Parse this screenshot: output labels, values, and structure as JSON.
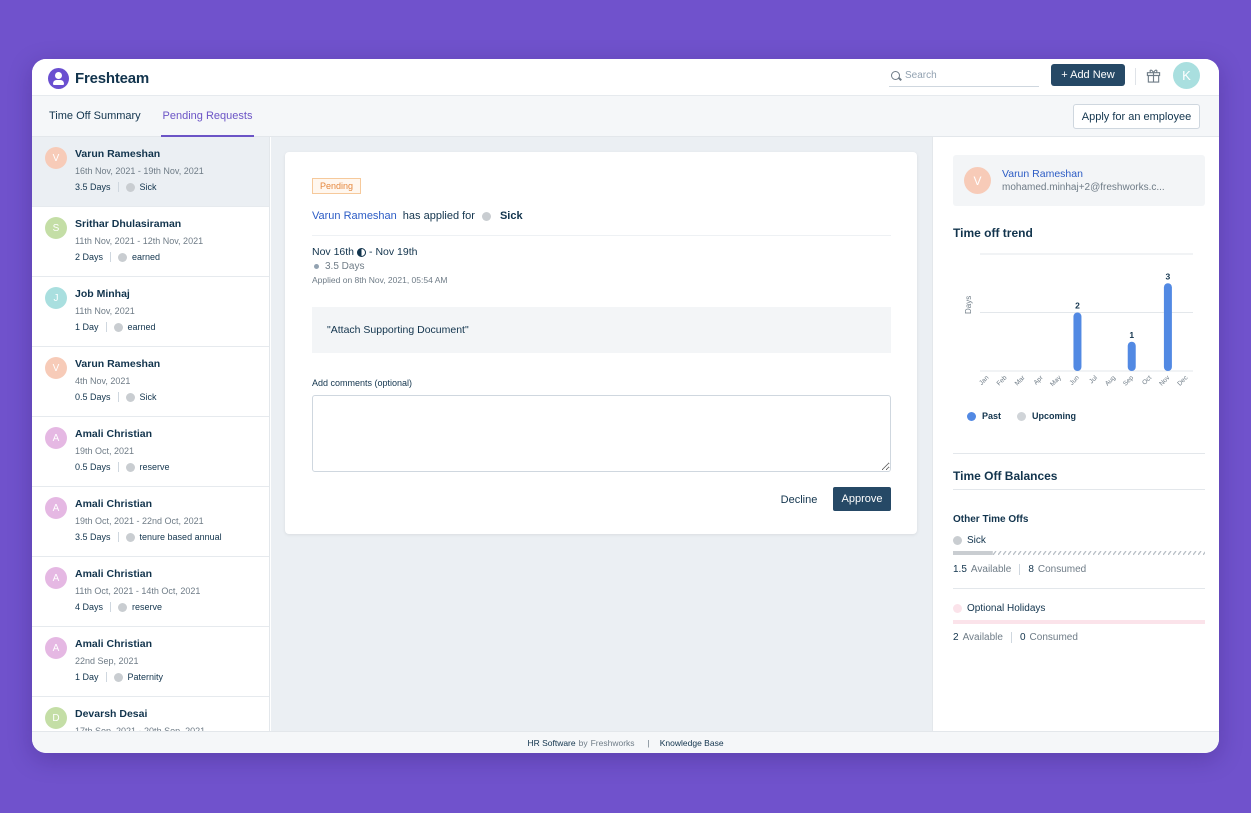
{
  "app": {
    "brand": "Freshteam"
  },
  "header": {
    "search_placeholder": "Search",
    "add_new_label": "+ Add New",
    "user_initial": "K"
  },
  "tabs": [
    {
      "label": "Time Off Summary"
    },
    {
      "label": "Pending Requests"
    }
  ],
  "apply_for_employee_label": "Apply for an employee",
  "requests": [
    {
      "initial": "V",
      "name": "Varun Rameshan",
      "dates": "16th Nov, 2021 - 19th Nov, 2021",
      "days": "3.5 Days",
      "type": "Sick",
      "avatar_color": "#f7cbb8"
    },
    {
      "initial": "S",
      "name": "Srithar Dhulasiraman",
      "dates": "11th Nov, 2021 - 12th Nov, 2021",
      "days": "2 Days",
      "type": "earned",
      "avatar_color": "#c4dea6"
    },
    {
      "initial": "J",
      "name": "Job Minhaj",
      "dates": "11th Nov, 2021",
      "days": "1 Day",
      "type": "earned",
      "avatar_color": "#a9dfdf"
    },
    {
      "initial": "V",
      "name": "Varun Rameshan",
      "dates": "4th Nov, 2021",
      "days": "0.5 Days",
      "type": "Sick",
      "avatar_color": "#f7cbb8"
    },
    {
      "initial": "A",
      "name": "Amali Christian",
      "dates": "19th Oct, 2021",
      "days": "0.5 Days",
      "type": "reserve",
      "avatar_color": "#e5b8e3"
    },
    {
      "initial": "A",
      "name": "Amali Christian",
      "dates": "19th Oct, 2021 - 22nd Oct, 2021",
      "days": "3.5 Days",
      "type": "tenure based annual",
      "avatar_color": "#e5b8e3"
    },
    {
      "initial": "A",
      "name": "Amali Christian",
      "dates": "11th Oct, 2021 - 14th Oct, 2021",
      "days": "4 Days",
      "type": "reserve",
      "avatar_color": "#e5b8e3"
    },
    {
      "initial": "A",
      "name": "Amali Christian",
      "dates": "22nd Sep, 2021",
      "days": "1 Day",
      "type": "Paternity",
      "avatar_color": "#e5b8e3"
    },
    {
      "initial": "D",
      "name": "Devarsh Desai",
      "dates": "17th Sep, 2021 - 20th Sep, 2021",
      "days": "",
      "type": "",
      "avatar_color": "#c4dea6"
    }
  ],
  "detail": {
    "status": "Pending",
    "employee": "Varun Rameshan",
    "has_applied_for": "has applied for",
    "leave_type": "Sick",
    "range_start": "Nov 16th",
    "range_end": "- Nov 19th",
    "days": "3.5 Days",
    "applied_on": "Applied on 8th Nov, 2021, 05:54 AM",
    "note": "\"Attach Supporting Document\"",
    "comments_label": "Add comments (optional)",
    "decline_label": "Decline",
    "approve_label": "Approve"
  },
  "right": {
    "employee_initial": "V",
    "employee_name": "Varun Rameshan",
    "employee_email": "mohamed.minhaj+2@freshworks.c...",
    "trend_title": "Time off trend",
    "legend_past": "Past",
    "legend_upcoming": "Upcoming",
    "balances_title": "Time Off Balances",
    "other_title": "Other Time Offs",
    "balances": [
      {
        "name": "Sick",
        "available": "1.5",
        "consumed": "8",
        "available_label": "Available",
        "consumed_label": "Consumed",
        "dot_color": "#c9cdd1"
      },
      {
        "name": "Optional Holidays",
        "available": "2",
        "consumed": "0",
        "available_label": "Available",
        "consumed_label": "Consumed",
        "dot_color": "#fbe3ea"
      }
    ]
  },
  "chart_data": {
    "type": "bar",
    "title": "Time off trend",
    "ylabel": "Days",
    "categories": [
      "Jan",
      "Feb",
      "Mar",
      "Apr",
      "May",
      "Jun",
      "Jul",
      "Aug",
      "Sep",
      "Oct",
      "Nov",
      "Dec"
    ],
    "series": [
      {
        "name": "Past",
        "values": [
          0,
          0,
          0,
          0,
          0,
          2,
          0,
          0,
          1,
          0,
          3,
          0
        ],
        "color": "#5289e3"
      },
      {
        "name": "Upcoming",
        "values": [
          0,
          0,
          0,
          0,
          0,
          0,
          0,
          0,
          0,
          0,
          0,
          0
        ],
        "color": "#d0d4d8"
      }
    ],
    "ylim": [
      0,
      4
    ],
    "grid": true,
    "legend": "bottom"
  },
  "footer": {
    "hr_software": "HR Software",
    "by": "by",
    "freshworks": "Freshworks",
    "pipe": "|",
    "knowledge_base": "Knowledge Base"
  }
}
